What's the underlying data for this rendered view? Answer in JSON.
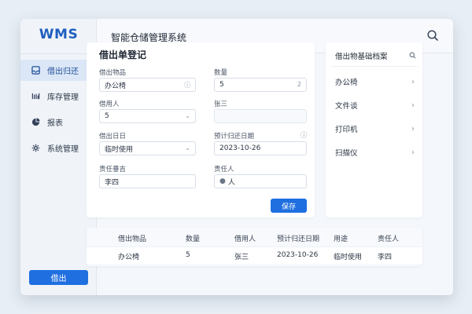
{
  "brand": {
    "logo": "WMS"
  },
  "header": {
    "title": "智能仓储管理系统",
    "search_icon": "search-icon"
  },
  "sidebar": {
    "items": [
      {
        "label": "借出归还",
        "icon": "inbox-icon",
        "active": true
      },
      {
        "label": "库存管理",
        "icon": "inventory-icon",
        "active": false
      },
      {
        "label": "报表",
        "icon": "pie-chart-icon",
        "active": false
      },
      {
        "label": "系统管理",
        "icon": "gear-icon",
        "active": false
      }
    ],
    "bottom_button": "借出"
  },
  "form": {
    "title": "借出单登记",
    "item_label": "借出物品",
    "item_value": "办公椅",
    "qty_label": "数量",
    "qty_value": "5",
    "qty_suffix": "2",
    "borrower_label": "借用人",
    "borrower_value": "5",
    "borrower_name": "张三",
    "date_label": "借出日日",
    "date_value": "临时使用",
    "return_label": "预计归还日期",
    "return_value": "2023-10-26",
    "resp_label": "责任垂吉",
    "resp_value": "李四",
    "resp2_label": "责任人",
    "resp2_value": "人",
    "save_label": "保存"
  },
  "archive": {
    "title": "借出物基础档案",
    "items": [
      "办公椅",
      "文件谈",
      "打印机",
      "扫描仪"
    ]
  },
  "table": {
    "headers": [
      "借出物品",
      "数量",
      "借用人",
      "预计归还日期",
      "用途",
      "责任人"
    ],
    "rows": [
      [
        "办公椅",
        "5",
        "张三",
        "2023-10-26",
        "临时使用",
        "李四"
      ]
    ]
  },
  "colors": {
    "accent": "#1f6fe0",
    "brand": "#1f5fbf",
    "active_nav_bg": "#dbe7f7"
  }
}
